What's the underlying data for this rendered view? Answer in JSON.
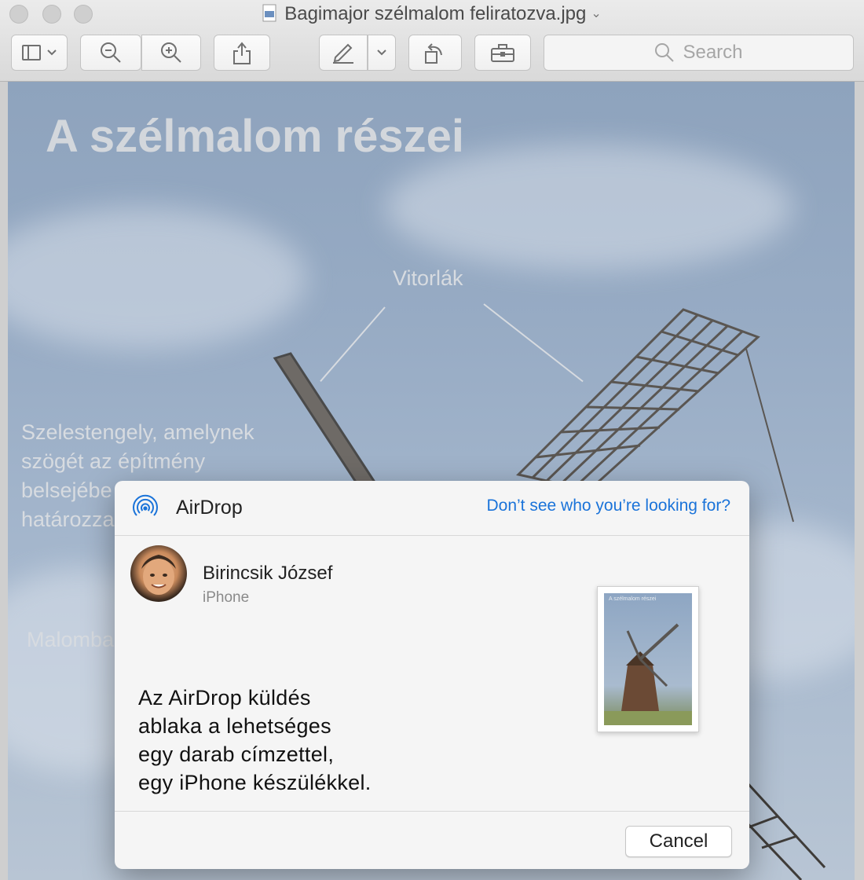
{
  "window": {
    "title": "Bagimajor szélmalom feliratozva.jpg",
    "title_chevron": "⌄"
  },
  "toolbar": {
    "buttons": [
      {
        "name": "sidebar-toggle",
        "icon": "sidebar-icon"
      },
      {
        "name": "zoom-out",
        "icon": "zoom-out-icon"
      },
      {
        "name": "zoom-in",
        "icon": "zoom-in-icon"
      },
      {
        "name": "share",
        "icon": "share-icon"
      },
      {
        "name": "markup",
        "icon": "pen-icon"
      },
      {
        "name": "rotate",
        "icon": "rotate-left-icon"
      },
      {
        "name": "toolbox",
        "icon": "toolbox-icon"
      }
    ],
    "search_placeholder": "Search"
  },
  "image": {
    "title": "A szélmalom részei",
    "label_sails": "Vitorlák",
    "label_shaft_lines": [
      "Szelestengely, amelynek",
      "szögét az építmény",
      "belsejébe",
      "határozza"
    ],
    "label_bottom": "Malomba"
  },
  "airdrop": {
    "header_label": "AirDrop",
    "help_link": "Don’t see who you’re looking for?",
    "recipient_name": "Birincsik József",
    "recipient_device": "iPhone",
    "caption_lines": [
      "Az AirDrop küldés",
      "ablaka a lehetséges",
      "egy darab címzettel,",
      "egy iPhone készülékkel."
    ],
    "thumbnail_title": "A szélmalom részei",
    "cancel_label": "Cancel"
  },
  "colors": {
    "link": "#1a73d9",
    "sky": "#97abc4",
    "dialog_bg": "#f5f5f5"
  }
}
